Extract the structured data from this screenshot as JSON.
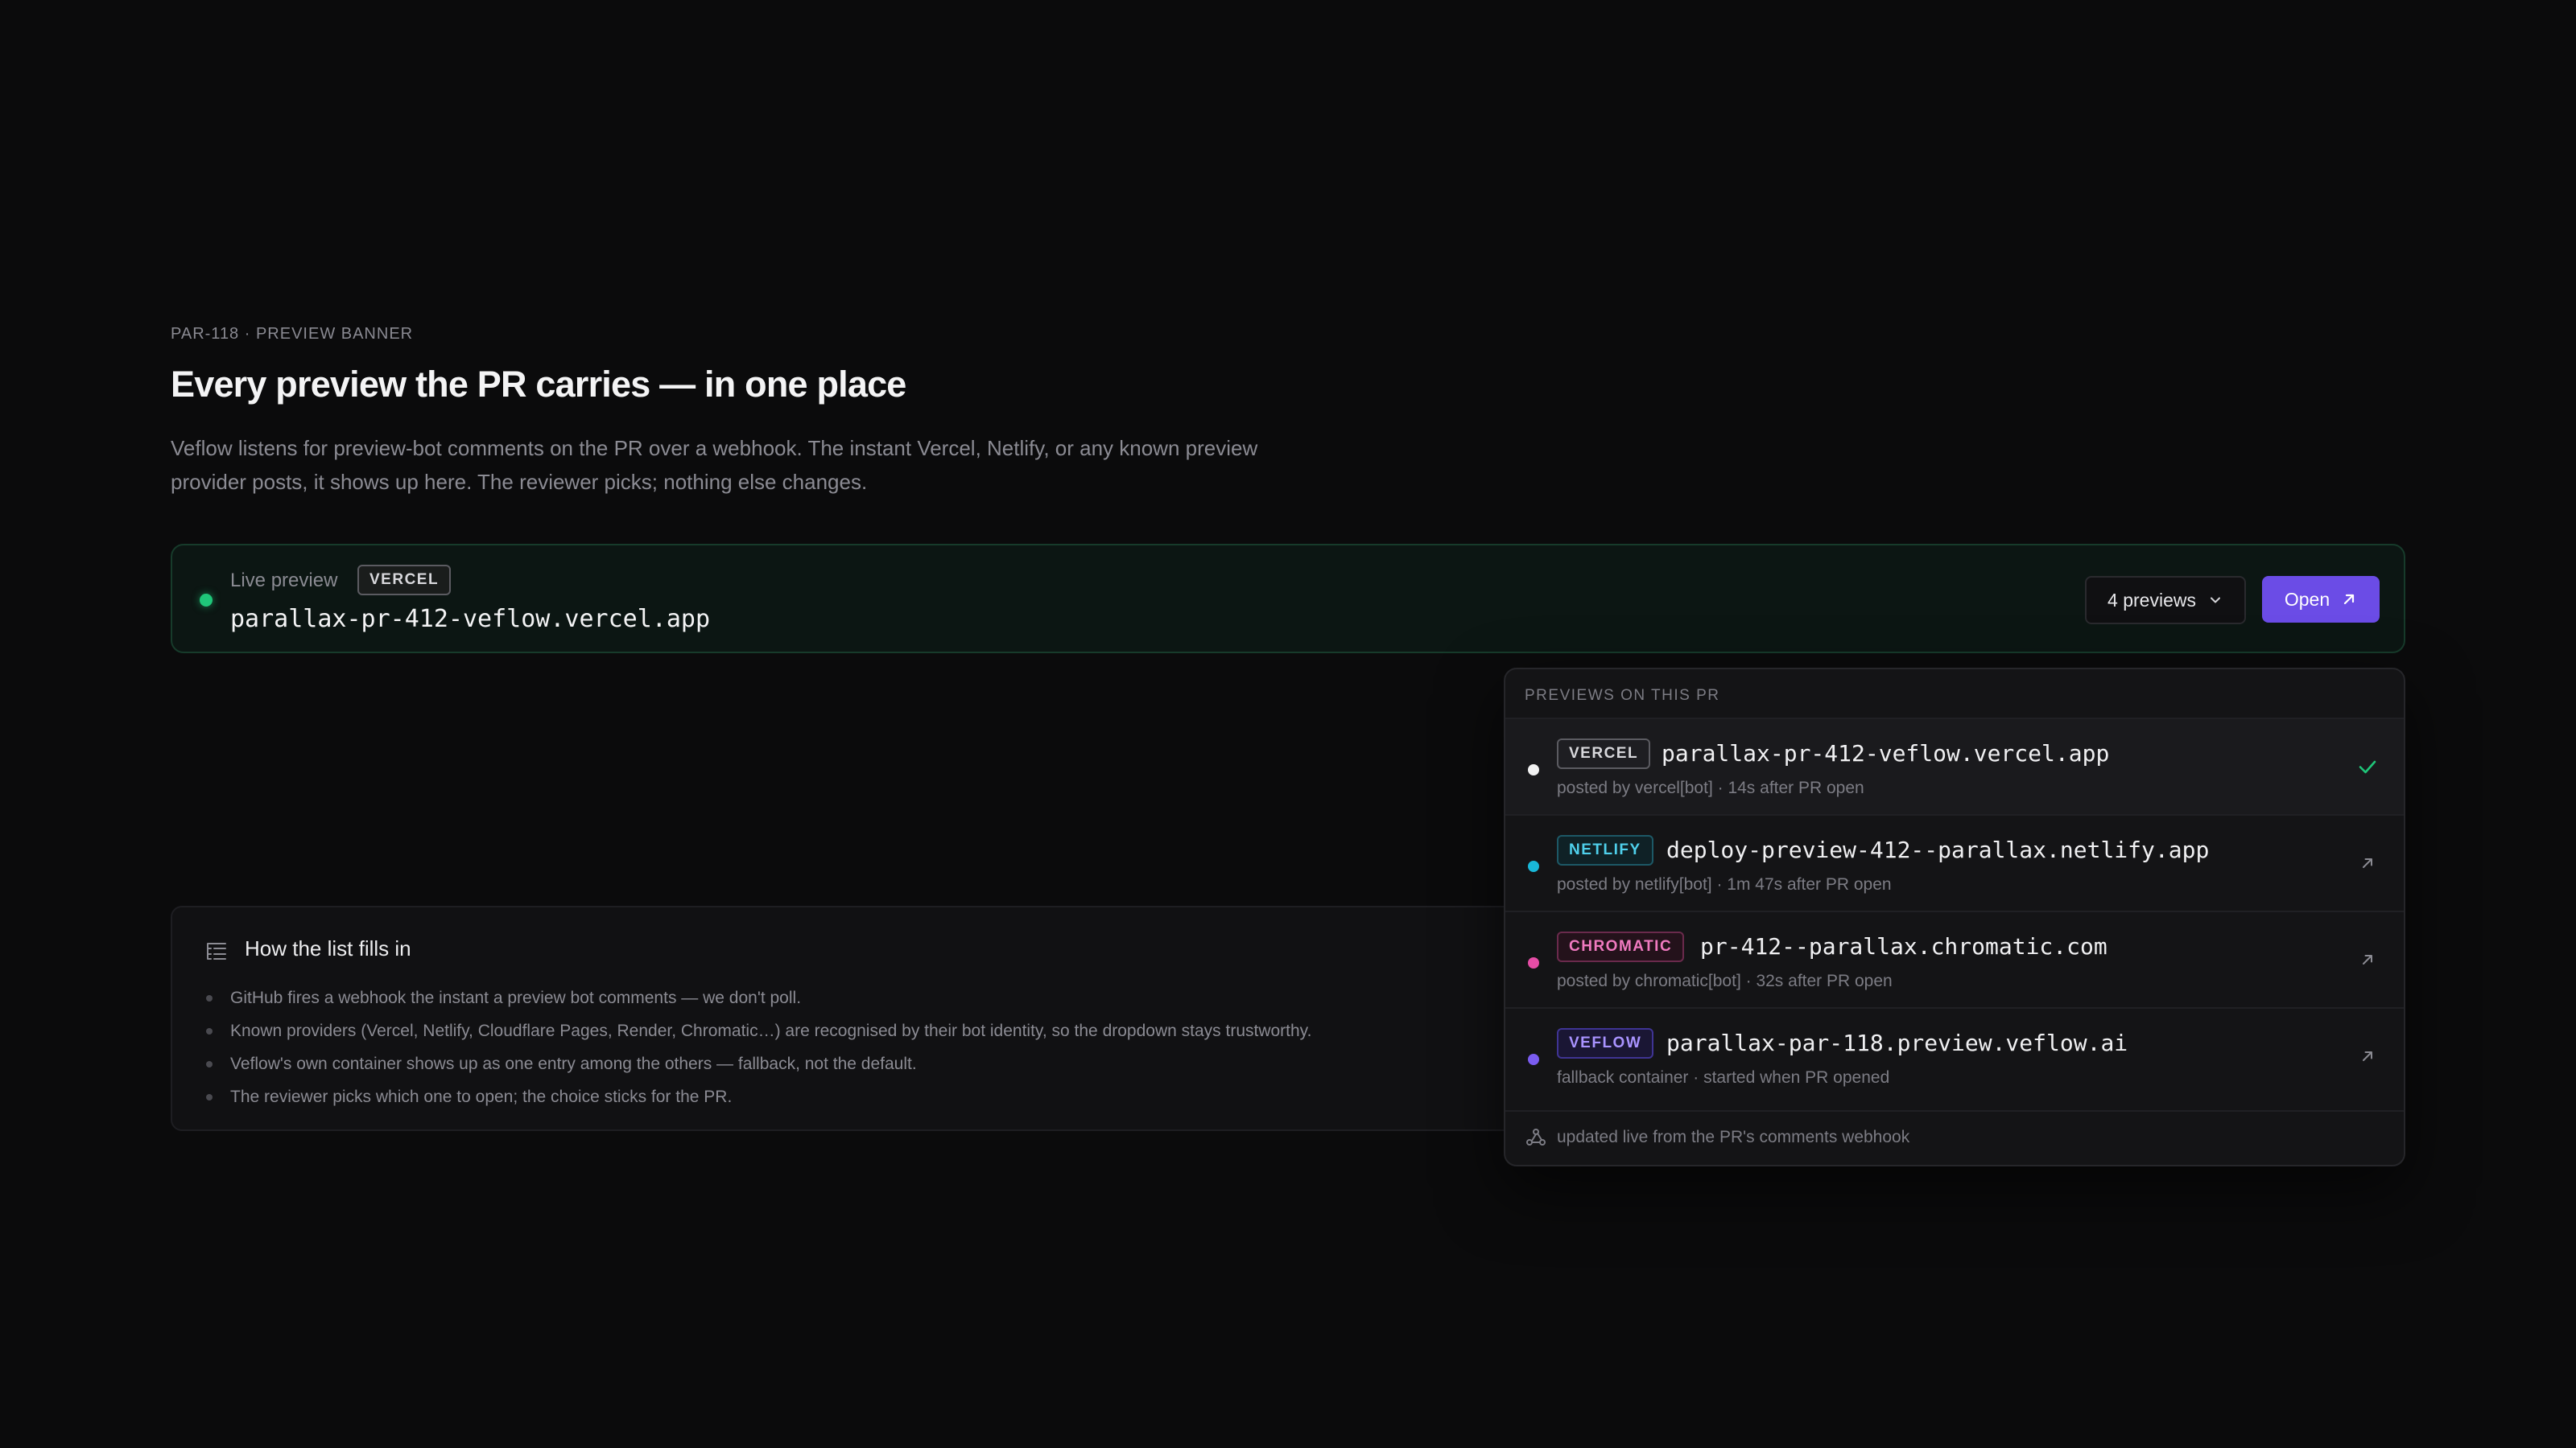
{
  "header": {
    "eyebrow": "PAR-118 · PREVIEW BANNER",
    "title": "Every preview the PR carries — in one place",
    "description": "Veflow listens for preview-bot comments on the PR over a webhook. The instant Vercel, Netlify, or any known preview provider posts, it shows up here. The reviewer picks; nothing else changes."
  },
  "banner": {
    "status_label": "Live preview",
    "provider": "VERCEL",
    "url": "parallax-pr-412-veflow.vercel.app",
    "count_label": "4 previews",
    "open_label": "Open",
    "status_color": "#1fc679",
    "open_color": "#6b4ce6"
  },
  "how": {
    "title": "How the list fills in",
    "items": [
      "GitHub fires a webhook the instant a preview bot comments — we don't poll.",
      "Known providers (Vercel, Netlify, Cloudflare Pages, Render, Chromatic…) are recognised by their bot identity, so the dropdown stays trustworthy.",
      "Veflow's own container shows up as one entry among the others — fallback, not the default.",
      "The reviewer picks which one to open; the choice sticks for the PR."
    ]
  },
  "dropdown": {
    "header": "PREVIEWS ON THIS PR",
    "items": [
      {
        "provider": "VERCEL",
        "url": "parallax-pr-412-veflow.vercel.app",
        "meta": "posted by vercel[bot] · 14s after PR open",
        "dot_color": "#f2f2f2",
        "selected": true,
        "action_icon": "check-icon"
      },
      {
        "provider": "NETLIFY",
        "url": "deploy-preview-412--parallax.netlify.app",
        "meta": "posted by netlify[bot] · 1m 47s after PR open",
        "dot_color": "#19b8d9",
        "selected": false,
        "action_icon": "external-link-icon"
      },
      {
        "provider": "CHROMATIC",
        "url": "pr-412--parallax.chromatic.com",
        "meta": "posted by chromatic[bot] · 32s after PR open",
        "dot_color": "#e64da6",
        "selected": false,
        "action_icon": "external-link-icon"
      },
      {
        "provider": "VEFLOW",
        "url": "parallax-par-118.preview.veflow.ai",
        "meta": "fallback container · started when PR opened",
        "dot_color": "#7a5cf0",
        "selected": false,
        "action_icon": "external-link-icon"
      }
    ],
    "footer": "updated live from the PR's comments webhook"
  }
}
